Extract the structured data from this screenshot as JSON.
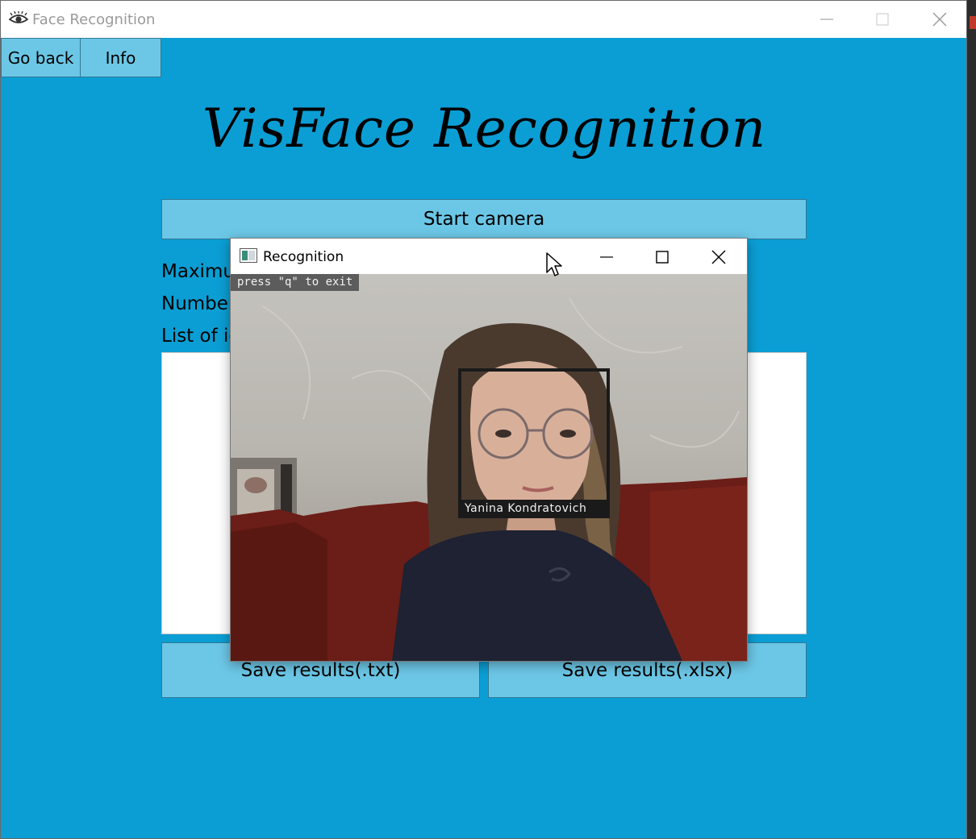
{
  "main_window": {
    "title": "Face Recognition",
    "icon": "eye-icon",
    "controls": [
      "minimize-icon",
      "maximize-icon",
      "close-icon"
    ]
  },
  "nav": {
    "go_back": "Go back",
    "info": "Info"
  },
  "heading": "VisFace Recognition",
  "start_camera": "Start camera",
  "labels": {
    "maximum": "Maximum",
    "number": "Number",
    "list": "List of id"
  },
  "save": {
    "txt": "Save results(.txt)",
    "xlsx": "Save results(.xlsx)"
  },
  "recognition_window": {
    "title": "Recognition",
    "exit_hint": "press \"q\" to exit",
    "face_name": "Yanina Kondratovich",
    "controls": [
      "minimize-icon",
      "maximize-icon",
      "close-icon"
    ]
  },
  "colors": {
    "background": "#0b9ed4",
    "button": "#6cc7e6",
    "button_border": "#2f7894"
  }
}
